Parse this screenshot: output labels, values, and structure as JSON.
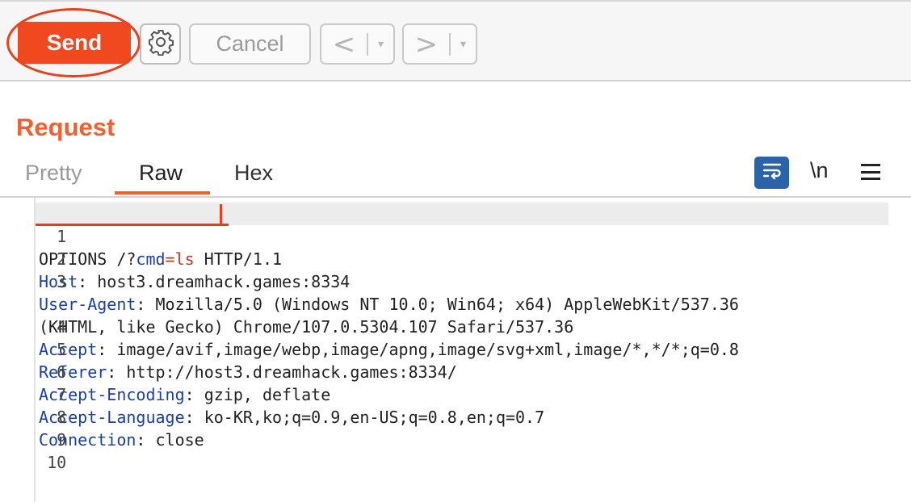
{
  "toolbar": {
    "send_label": "Send",
    "gear_icon": "gear-icon",
    "cancel_label": "Cancel",
    "back_glyph": "<",
    "forward_glyph": ">",
    "dropdown_glyph": "▾",
    "send_color": "#f0491f"
  },
  "request": {
    "title": "Request",
    "tabs": [
      {
        "label": "Pretty",
        "active": false
      },
      {
        "label": "Raw",
        "active": true
      },
      {
        "label": "Hex",
        "active": false
      }
    ],
    "actions": {
      "wrap_icon": "word-wrap-icon",
      "newline_label": "\\n",
      "menu_icon": "hamburger-menu-icon"
    },
    "accent_color": "#f0622d"
  },
  "editor": {
    "line_numbers": [
      "1",
      "2",
      "3",
      "",
      "4",
      "5",
      "6",
      "7",
      "8",
      "9",
      "10"
    ],
    "request_line": {
      "method_path": "OPTIONS /?",
      "param": "cmd",
      "equals": "=",
      "value": "ls",
      "version": " HTTP/1.1"
    },
    "headers": [
      {
        "key": "Host",
        "value": ": host3.dreamhack.games:8334"
      },
      {
        "key": "User-Agent",
        "value": ": Mozilla/5.0 (Windows NT 10.0; Win64; x64) AppleWebKit/537.36"
      },
      {
        "key": "",
        "value": "(KHTML, like Gecko) Chrome/107.0.5304.107 Safari/537.36"
      },
      {
        "key": "Accept",
        "value": ": image/avif,image/webp,image/apng,image/svg+xml,image/*,*/*;q=0.8"
      },
      {
        "key": "Referer",
        "value": ": http://host3.dreamhack.games:8334/"
      },
      {
        "key": "Accept-Encoding",
        "value": ": gzip, deflate"
      },
      {
        "key": "Accept-Language",
        "value": ": ko-KR,ko;q=0.9,en-US;q=0.8,en;q=0.7"
      },
      {
        "key": "Connection",
        "value": ": close"
      }
    ]
  }
}
